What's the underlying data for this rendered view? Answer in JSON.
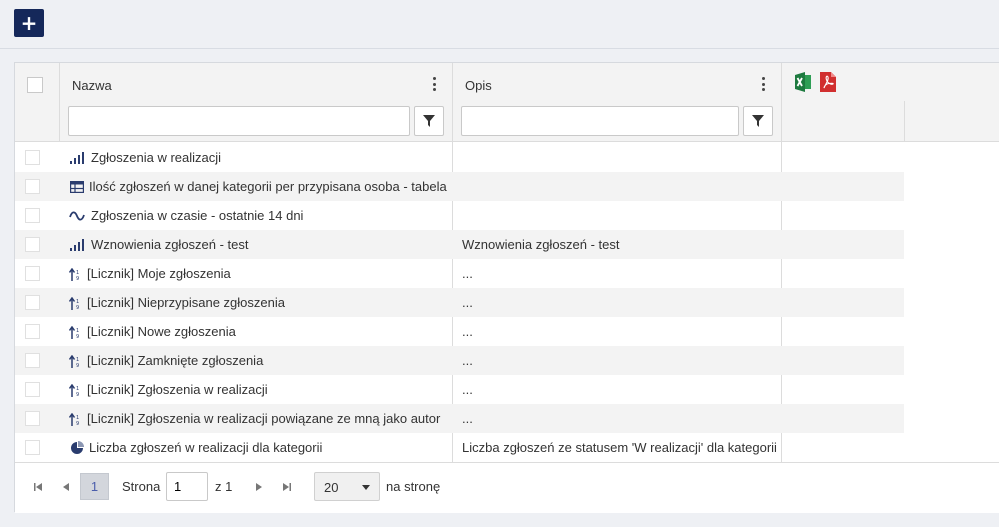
{
  "toolbar": {
    "add_label": "+"
  },
  "grid": {
    "columns": [
      {
        "title": "Nazwa",
        "filter_value": ""
      },
      {
        "title": "Opis",
        "filter_value": ""
      }
    ],
    "export": {
      "excel_icon": "excel-export-icon",
      "pdf_icon": "pdf-export-icon"
    },
    "rows": [
      {
        "icon": "bar-chart-icon",
        "name": "Zgłoszenia w realizacji",
        "desc": ""
      },
      {
        "icon": "table-icon",
        "name": "Ilość zgłoszeń w danej kategorii per przypisana osoba - tabela",
        "desc": ""
      },
      {
        "icon": "line-chart-icon",
        "name": "Zgłoszenia w czasie - ostatnie 14 dni",
        "desc": ""
      },
      {
        "icon": "bar-chart-icon",
        "name": "Wznowienia zgłoszeń - test",
        "desc": "Wznowienia zgłoszeń - test"
      },
      {
        "icon": "counter-icon",
        "name": "[Licznik] Moje zgłoszenia",
        "desc": "..."
      },
      {
        "icon": "counter-icon",
        "name": "[Licznik] Nieprzypisane zgłoszenia",
        "desc": "..."
      },
      {
        "icon": "counter-icon",
        "name": "[Licznik] Nowe zgłoszenia",
        "desc": "..."
      },
      {
        "icon": "counter-icon",
        "name": "[Licznik] Zamknięte zgłoszenia",
        "desc": "..."
      },
      {
        "icon": "counter-icon",
        "name": "[Licznik] Zgłoszenia w realizacji",
        "desc": "..."
      },
      {
        "icon": "counter-icon",
        "name": "[Licznik] Zgłoszenia w realizacji powiązane ze mną jako autor",
        "desc": "..."
      },
      {
        "icon": "pie-chart-icon",
        "name": "Liczba zgłoszeń w realizacji dla kategorii",
        "desc": "Liczba zgłoszeń ze statusem 'W realizacji' dla kategorii"
      }
    ]
  },
  "pager": {
    "current_page": "1",
    "page_label": "Strona",
    "page_input_value": "1",
    "of_label": "z 1",
    "page_size": "20",
    "per_page_label": "na stronę"
  },
  "colors": {
    "accent": "#15285a",
    "excel": "#1d7a3f",
    "pdf": "#d12f2f",
    "icon": "#2a3c6e"
  }
}
